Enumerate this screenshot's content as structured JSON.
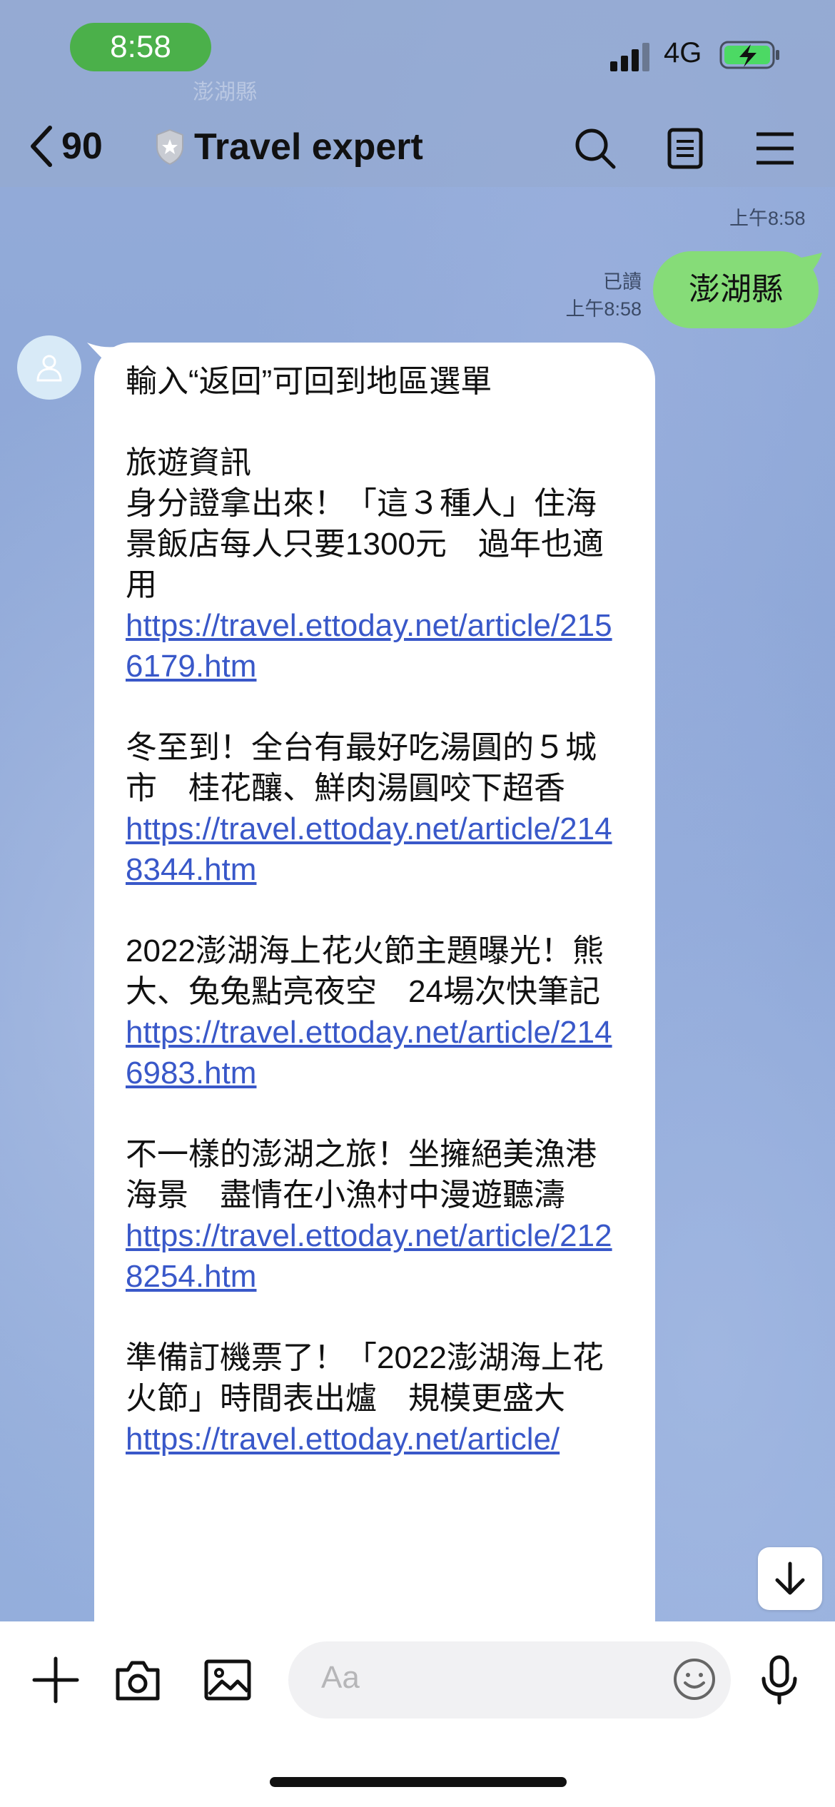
{
  "status_bar": {
    "time": "8:58",
    "network": "4G"
  },
  "header": {
    "watermark": "澎湖縣",
    "unread_count": "90",
    "room_title": "Travel expert",
    "icons": [
      "back-chevron-icon",
      "shield-badge-icon",
      "search-icon",
      "notes-icon",
      "menu-icon"
    ]
  },
  "messages": {
    "top_timestamp": "上午8:58",
    "outgoing": {
      "read_label": "已讀",
      "time": "上午8:58",
      "text": "澎湖縣"
    },
    "incoming": {
      "intro": "輸入“返回”可回到地區選單",
      "section_title": "旅遊資訊",
      "articles": [
        {
          "title": "身分證拿出來！「這３種人」住海景飯店每人只要1300元　過年也適用",
          "link": "https://travel.ettoday.net/article/2156179.htm"
        },
        {
          "title": "冬至到！全台有最好吃湯圓的５城市　桂花釀、鮮肉湯圓咬下超香",
          "link": "https://travel.ettoday.net/article/2148344.htm"
        },
        {
          "title": "2022澎湖海上花火節主題曝光！熊大、兔兔點亮夜空　24場次快筆記",
          "link": "https://travel.ettoday.net/article/2146983.htm"
        },
        {
          "title": "不一樣的澎湖之旅！坐擁絕美漁港海景　盡情在小漁村中漫遊聽濤",
          "link": "https://travel.ettoday.net/article/2128254.htm"
        },
        {
          "title": "準備訂機票了！「2022澎湖海上花火節」時間表出爐　規模更盛大",
          "link": "https://travel.ettoday.net/article/"
        }
      ]
    }
  },
  "input": {
    "placeholder": "Aa"
  },
  "colors": {
    "outgoing_bubble": "#86dc78",
    "link": "#3958c9",
    "status_time_pill": "#4bb04a"
  }
}
